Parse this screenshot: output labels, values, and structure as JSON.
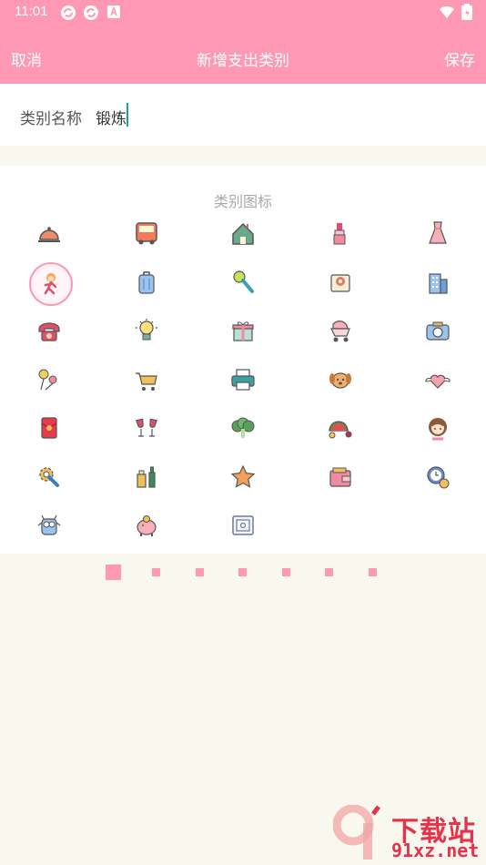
{
  "status": {
    "time": "11:01"
  },
  "header": {
    "cancel": "取消",
    "title": "新增支出类别",
    "save": "保存"
  },
  "name_field": {
    "label": "类别名称",
    "value": "锻炼"
  },
  "icon_section": {
    "title": "类别图标"
  },
  "icons": [
    "service-bell-icon",
    "bus-icon",
    "house-icon",
    "lipstick-icon",
    "dress-icon",
    "runner-icon",
    "suitcase-icon",
    "microphone-icon",
    "tissue-roll-icon",
    "office-building-icon",
    "telephone-icon",
    "light-bulb-icon",
    "gift-icon",
    "baby-stroller-icon",
    "camera-icon",
    "lollipop-icon",
    "shopping-cart-icon",
    "printer-icon",
    "dog-icon",
    "winged-heart-icon",
    "red-envelope-icon",
    "wine-glasses-icon",
    "vegetables-icon",
    "fruits-icon",
    "girl-icon",
    "gear-wrench-icon",
    "drinks-icon",
    "star-icon",
    "wallet-icon",
    "clock-coin-icon",
    "owl-icon",
    "piggy-bank-icon",
    "safe-icon"
  ],
  "selected_icon_index": 5,
  "pager": {
    "count": 7,
    "active": 0
  },
  "watermark": {
    "line1": "下载站",
    "line2": "91xz.net"
  }
}
